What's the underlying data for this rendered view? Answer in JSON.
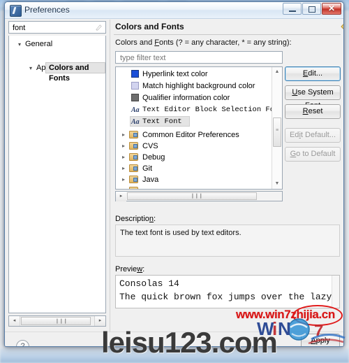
{
  "window": {
    "title": "Preferences",
    "app_icon": "preferences-icon",
    "controls": {
      "minimize": "minimize-icon",
      "maximize": "maximize-icon",
      "close": "✕"
    }
  },
  "sidebar": {
    "search": {
      "value": "font",
      "placeholder": "type filter text",
      "clear_icon": "clear-icon"
    },
    "tree": [
      {
        "label": "General",
        "arrow": "▾",
        "indent": 12,
        "level": 0,
        "selected": false
      },
      {
        "label": "Appearance",
        "arrow": "▾",
        "indent": 26,
        "level": 1,
        "selected": false
      },
      {
        "label": "Colors and Fonts",
        "arrow": "",
        "indent": 40,
        "level": 2,
        "selected": true
      }
    ],
    "hscroll": {
      "left_icon": "◂",
      "right_icon": "▸",
      "grip": "❙❙❙"
    }
  },
  "page": {
    "title": "Colors and Fonts",
    "nav": {
      "back_icon": "back-arrow-icon",
      "back_caret": "caret-down-icon",
      "forward_icon": "forward-arrow-icon",
      "forward_caret": "caret-down-icon",
      "menu_caret": "caret-down-icon"
    },
    "filter_label": "Colors and Fonts (? = any character, * = any string):",
    "filter_input": {
      "value": "",
      "placeholder": "type filter text"
    },
    "list": {
      "items": [
        {
          "type": "color",
          "label": "Hyperlink text color",
          "swatch": "#1b4fd8",
          "icon": "color-swatch-icon",
          "selected": false
        },
        {
          "type": "color",
          "label": "Match highlight background color",
          "swatch": "#d2d4ef",
          "icon": "color-swatch-icon",
          "selected": false
        },
        {
          "type": "color",
          "label": "Qualifier information color",
          "swatch": "#6e6e6e",
          "icon": "color-swatch-icon",
          "selected": false
        },
        {
          "type": "font",
          "label": "Text Editor Block Selection Font",
          "icon": "font-aa-icon",
          "glyph": "Aa",
          "selected": false
        },
        {
          "type": "font",
          "label": "Text Font",
          "icon": "font-aa-icon",
          "glyph": "Aa",
          "selected": true
        }
      ],
      "groups": [
        {
          "label": "Common Editor Preferences",
          "arrow": "▸",
          "icon": "folder-category-icon"
        },
        {
          "label": "CVS",
          "arrow": "▸",
          "icon": "folder-category-icon"
        },
        {
          "label": "Debug",
          "arrow": "▸",
          "icon": "folder-category-icon"
        },
        {
          "label": "Git",
          "arrow": "▸",
          "icon": "folder-category-icon"
        },
        {
          "label": "Java",
          "arrow": "▸",
          "icon": "folder-category-icon"
        }
      ],
      "vscroll": {
        "up_icon": "▲",
        "down_icon": "▼",
        "grip": "≡"
      },
      "hscroll": {
        "left_icon": "◂",
        "right_icon": "▸",
        "grip": "❙❙❙"
      }
    },
    "buttons": [
      {
        "label": "Edit...",
        "underline": "E",
        "enabled": true,
        "focused": true
      },
      {
        "label": "Use System Font",
        "underline": "U",
        "enabled": true,
        "focused": false
      },
      {
        "label": "Reset",
        "underline": "R",
        "enabled": true,
        "focused": false
      },
      {
        "label": "Edit Default...",
        "underline": "i",
        "enabled": false,
        "focused": false
      },
      {
        "label": "Go to Default",
        "underline": "G",
        "enabled": false,
        "focused": false
      }
    ],
    "description_label": "Description:",
    "description_text": "The text font is used by text editors.",
    "preview_label": "Preview:",
    "preview_lines": [
      "Consolas 14",
      "The quick brown fox jumps over the lazy d"
    ]
  },
  "footer": {
    "help_icon": "?",
    "apply_label": "Apply"
  },
  "watermarks": {
    "top": "www.win7zhijia.cn",
    "bottom": "leisu123.com",
    "highlight_color": "#e01b1b"
  }
}
